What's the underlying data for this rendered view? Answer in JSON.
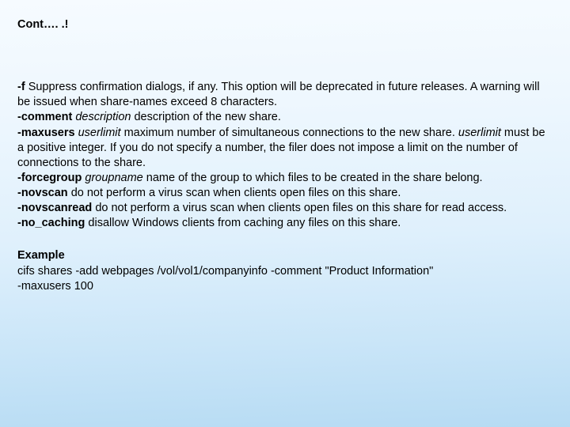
{
  "title": "Cont…. .!",
  "options": {
    "f_flag": "-f",
    "f_text": " Suppress confirmation dialogs, if any. This option will be deprecated in future releases. A warning will be issued when share-names exceed 8 characters.",
    "comment_flag": "-comment",
    "comment_arg": " description",
    "comment_text": " description of the new share.",
    "maxusers_flag": "-maxusers",
    "maxusers_arg": " userlimit",
    "maxusers_text1": " maximum number of simultaneous connections to the new share. ",
    "maxusers_arg2": "userlimit",
    "maxusers_text2": " must be a positive integer. If you do not specify a number, the filer does not impose a limit on the number of connections to the share.",
    "forcegroup_flag": "-forcegroup",
    "forcegroup_arg": " groupname",
    "forcegroup_text": " name of the group to which files to be created in the share belong.",
    "novscan_flag": "-novscan",
    "novscan_text": " do not perform a virus scan when clients open files on this share.",
    "novscanread_flag": "-novscanread",
    "novscanread_text": " do not perform a virus scan when clients open files on this share for read access.",
    "nocaching_flag": "-no_caching",
    "nocaching_text": " disallow Windows clients from caching any files on this share."
  },
  "example": {
    "heading": "Example",
    "line1": "cifs shares -add webpages /vol/vol1/companyinfo -comment \"Product Information\"",
    "line2": "-maxusers 100"
  }
}
